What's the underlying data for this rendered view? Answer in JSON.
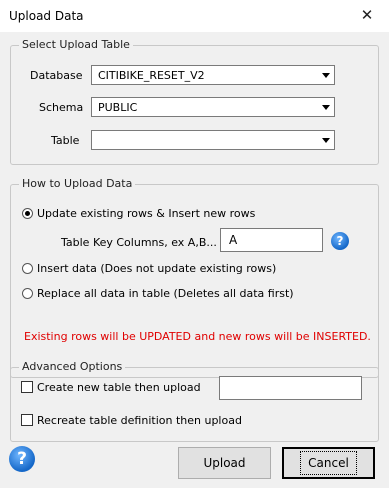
{
  "window": {
    "title": "Upload Data",
    "close_glyph": "✕"
  },
  "select_table": {
    "legend": "Select Upload Table",
    "database_label": "Database",
    "database_value": "CITIBIKE_RESET_V2",
    "schema_label": "Schema",
    "schema_value": "PUBLIC",
    "table_label": "Table",
    "table_value": ""
  },
  "how_to": {
    "legend": "How to Upload Data",
    "option_update": "Update existing rows & Insert new rows",
    "key_columns_label": "Table Key Columns, ex A,B...",
    "key_columns_value": "A",
    "option_insert": "Insert data (Does not update existing rows)",
    "option_replace": "Replace all data in table (Deletes all data first)",
    "selected_option": "update",
    "warning": "Existing rows will be UPDATED and new rows will be INSERTED.",
    "warning_color": "#e00000"
  },
  "advanced": {
    "legend": "Advanced Options",
    "create_new_label": "Create new table then upload",
    "create_new_checked": false,
    "create_new_value": "",
    "recreate_label": "Recreate table definition then upload",
    "recreate_checked": false
  },
  "buttons": {
    "upload": "Upload",
    "cancel": "Cancel"
  },
  "icons": {
    "help": "question-mark-icon"
  }
}
